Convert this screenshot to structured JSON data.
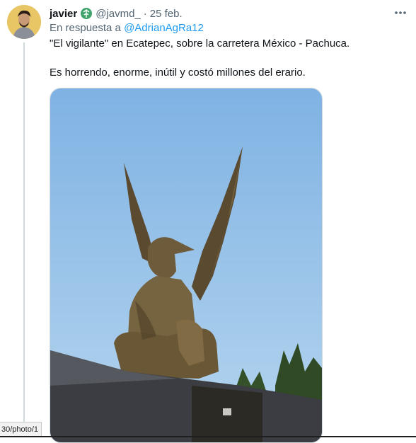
{
  "tweet": {
    "author_name": "javier",
    "handle": "@javmd_",
    "separator": "·",
    "date": "25 feb.",
    "reply_prefix": "En respuesta a",
    "reply_to": "@AdrianAgRa12",
    "text_line1": "\"El vigilante\" en Ecatepec, sobre la carretera México - Pachuca.",
    "text_line2": "Es horrendo, enorme, inútil y costó millones del erario."
  },
  "browser": {
    "status_url": "30/photo/1"
  },
  "icons": {
    "more": "more-icon",
    "badge": "profile-badge-icon"
  },
  "colors": {
    "link": "#1d9bf0",
    "secondary_text": "#536471",
    "primary_text": "#0f1419",
    "sky": "#8fbde8",
    "statue": "#6b5a3a"
  }
}
